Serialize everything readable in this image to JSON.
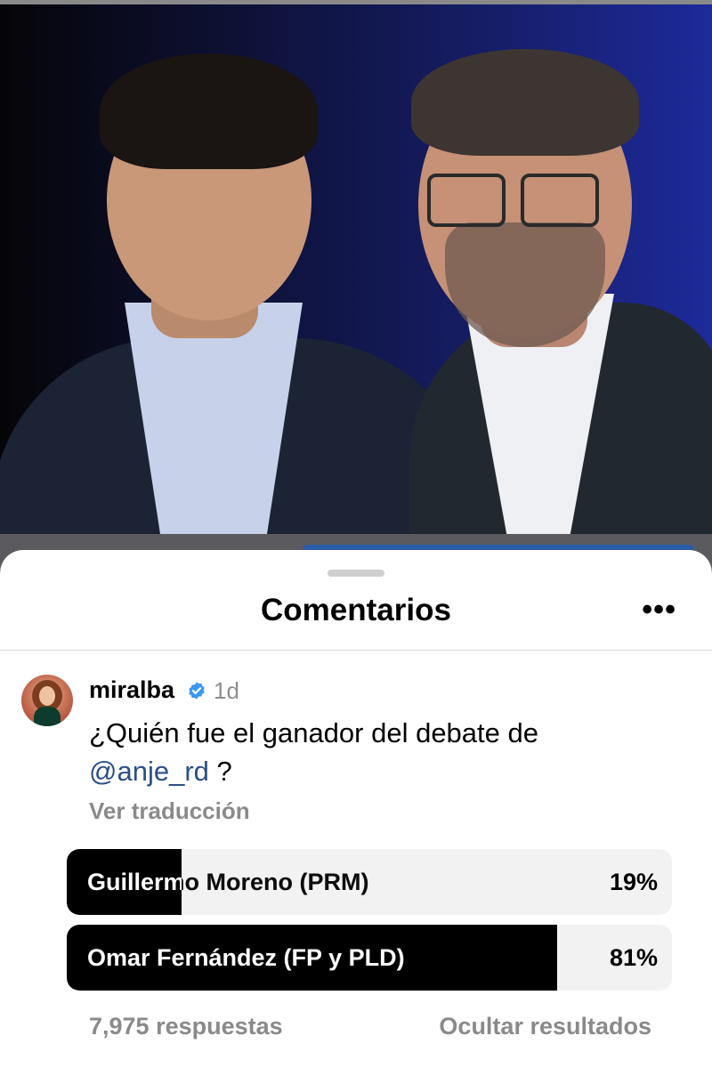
{
  "sheet": {
    "title": "Comentarios",
    "more_icon": "ellipsis-icon",
    "more_glyph": "•••"
  },
  "comment": {
    "username": "miralba",
    "verified": true,
    "time": "1d",
    "text_before": "¿Quién fue el ganador del debate de ",
    "mention": "@anje_rd",
    "text_after": " ?",
    "translate_label": "Ver traducción"
  },
  "poll": {
    "options": [
      {
        "label": "Guillermo Moreno (PRM)",
        "percent_label": "19%",
        "percent": 19
      },
      {
        "label": "Omar Fernández (FP y PLD)",
        "percent_label": "81%",
        "percent": 81
      }
    ],
    "responses": "7,975 respuestas",
    "hide_results": "Ocultar resultados"
  },
  "colors": {
    "mention": "#2b4f86",
    "verified": "#3897f0",
    "poll_fill": "#000000",
    "poll_track": "#f2f2f2",
    "muted_text": "#8a8a8a"
  }
}
